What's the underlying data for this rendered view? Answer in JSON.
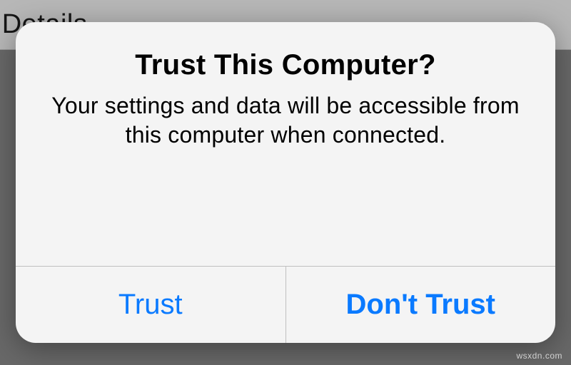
{
  "background": {
    "title_fragment": "e Details"
  },
  "alert": {
    "title": "Trust This Computer?",
    "message": "Your settings and data will be accessible from this computer when connected.",
    "buttons": {
      "trust": "Trust",
      "dont_trust": "Don't Trust"
    }
  },
  "watermark": "wsxdn.com"
}
